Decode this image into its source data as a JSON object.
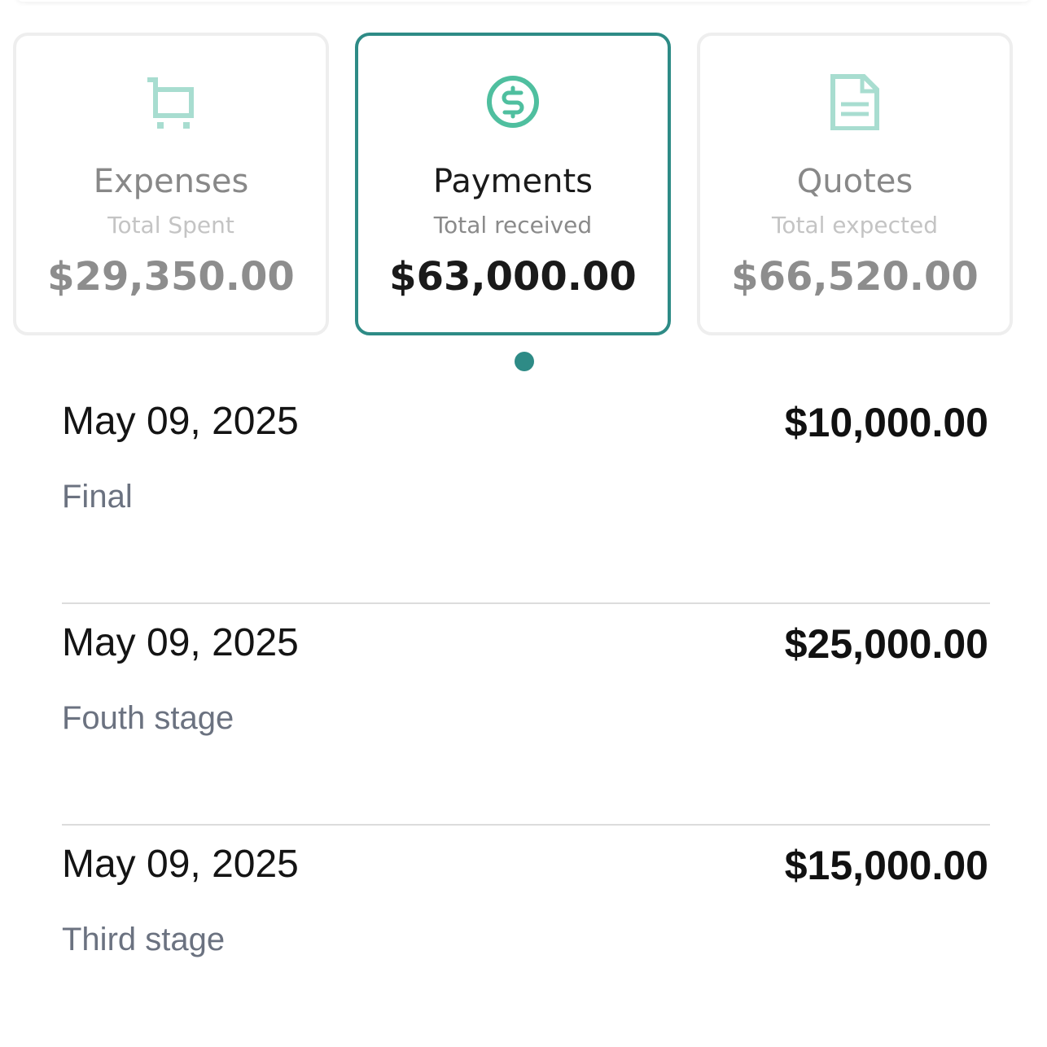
{
  "summary_cards": [
    {
      "title": "Expenses",
      "subtitle": "Total Spent",
      "amount": "$29,350.00",
      "icon": "shopping-cart-icon",
      "active": false
    },
    {
      "title": "Payments",
      "subtitle": "Total received",
      "amount": "$63,000.00",
      "icon": "dollar-circle-icon",
      "active": true
    },
    {
      "title": "Quotes",
      "subtitle": "Total expected",
      "amount": "$66,520.00",
      "icon": "document-icon",
      "active": false
    }
  ],
  "pager": {
    "active_index": 0
  },
  "payments": [
    {
      "date": "May 09, 2025",
      "amount": "$10,000.00",
      "note": "Final"
    },
    {
      "date": "May 09, 2025",
      "amount": "$25,000.00",
      "note": "Fouth stage"
    },
    {
      "date": "May 09, 2025",
      "amount": "$15,000.00",
      "note": "Third stage"
    }
  ],
  "colors": {
    "accent": "#2e8b86",
    "icon_light": "#a8ddd0",
    "icon_active": "#4fbf9f",
    "muted_text": "#6b7280"
  }
}
